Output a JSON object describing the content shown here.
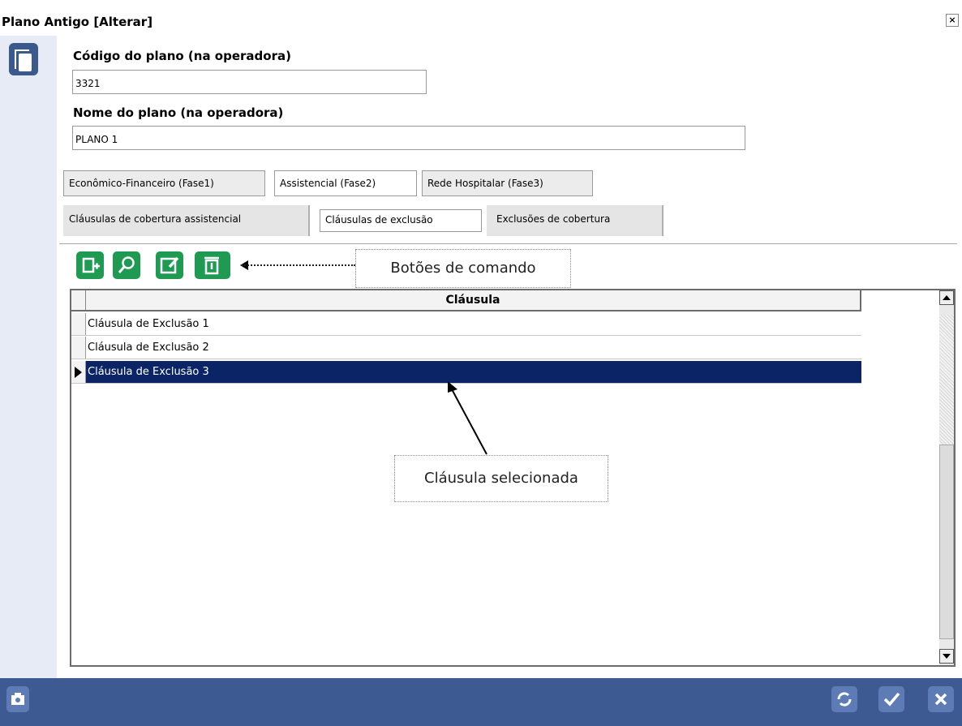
{
  "window": {
    "title": "Plano Antigo [Alterar]",
    "close_glyph": "×"
  },
  "form": {
    "codigo_label": "Código do plano (na operadora)",
    "codigo_value": "3321",
    "nome_label": "Nome do plano (na operadora)",
    "nome_value": "PLANO 1"
  },
  "tabs": [
    "Econômico-Financeiro (Fase1)",
    "Assistencial (Fase2)",
    "Rede Hospitalar (Fase3)"
  ],
  "active_tab": "Assistencial (Fase2)",
  "subtabs": [
    "Cláusulas de cobertura assistencial",
    "Cláusulas de exclusão",
    "Exclusões de cobertura"
  ],
  "active_subtab": "Cláusulas de exclusão",
  "commands": [
    {
      "icon": "add-document-icon"
    },
    {
      "icon": "search-icon"
    },
    {
      "icon": "edit-icon"
    },
    {
      "icon": "delete-icon"
    }
  ],
  "annotations": {
    "commands_callout": "Botões de comando",
    "selected_callout": "Cláusula selecionada"
  },
  "grid": {
    "column_header": "Cláusula",
    "rows": [
      "Cláusula de Exclusão 1",
      "Cláusula de Exclusão 2",
      "Cláusula de Exclusão 3"
    ],
    "selected_index": 2
  },
  "colors": {
    "selection": "#0a2466",
    "bottom_bar": "#3d5a93",
    "command_buttons": "#1f9a52"
  },
  "bottom_buttons": [
    {
      "icon": "refresh-icon"
    },
    {
      "icon": "confirm-check-icon"
    },
    {
      "icon": "cancel-x-icon"
    }
  ]
}
